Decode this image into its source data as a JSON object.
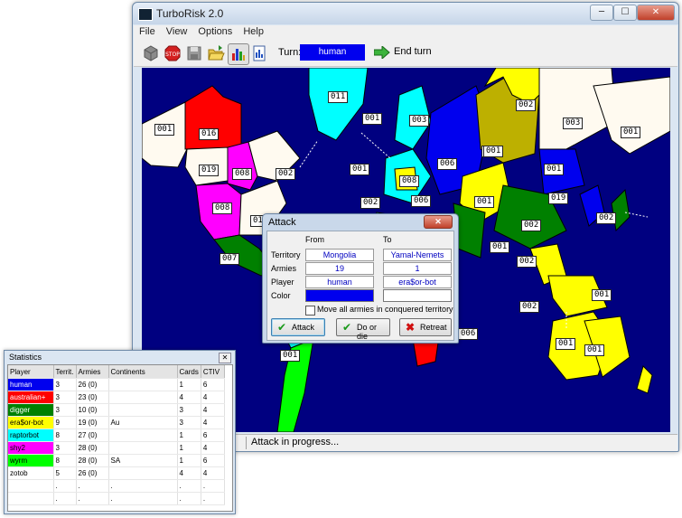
{
  "window": {
    "title": "TurboRisk 2.0",
    "min_glyph": "─",
    "max_glyph": "☐",
    "close_glyph": "✕"
  },
  "menu": [
    "File",
    "View",
    "Options",
    "Help"
  ],
  "toolbar": {
    "turn_label": "Turn:",
    "turn_player": "human",
    "end_turn": "End turn"
  },
  "status": {
    "message": "Attack in progress..."
  },
  "map_labels": [
    {
      "text": "011"
    },
    {
      "text": "001"
    },
    {
      "text": "016"
    },
    {
      "text": "001"
    },
    {
      "text": "019"
    },
    {
      "text": "008"
    },
    {
      "text": "002"
    },
    {
      "text": "008"
    },
    {
      "text": "01"
    },
    {
      "text": "007"
    },
    {
      "text": "001"
    },
    {
      "text": "003"
    },
    {
      "text": "001"
    },
    {
      "text": "008"
    },
    {
      "text": "006"
    },
    {
      "text": "002"
    },
    {
      "text": "006"
    },
    {
      "text": "002"
    },
    {
      "text": "001"
    },
    {
      "text": "003"
    },
    {
      "text": "001"
    },
    {
      "text": "001"
    },
    {
      "text": "001"
    },
    {
      "text": "019"
    },
    {
      "text": "002"
    },
    {
      "text": "002"
    },
    {
      "text": "001"
    },
    {
      "text": "002"
    },
    {
      "text": "002"
    },
    {
      "text": "001"
    },
    {
      "text": "001"
    },
    {
      "text": "001"
    },
    {
      "text": "006"
    },
    {
      "text": "001"
    }
  ],
  "attack": {
    "title": "Attack",
    "close_glyph": "✕",
    "from_label": "From",
    "to_label": "To",
    "rows": {
      "territory": {
        "label": "Territory",
        "from": "Mongolia",
        "to": "Yamal-Nemets"
      },
      "armies": {
        "label": "Armies",
        "from": "19",
        "to": "1"
      },
      "player": {
        "label": "Player",
        "from": "human",
        "to": "era$or-bot"
      },
      "color": {
        "label": "Color",
        "from": "#0000ee",
        "to": "#ffffff"
      }
    },
    "move_all": "Move all armies in conquered territory",
    "buttons": {
      "attack": "Attack",
      "do_or_die": "Do or die",
      "retreat": "Retreat"
    }
  },
  "statistics": {
    "title": "Statistics",
    "close_glyph": "✕",
    "columns": [
      "Player",
      "Territ.",
      "Armies",
      "Continents",
      "Cards",
      "CTIV"
    ],
    "rows": [
      {
        "player": "human",
        "color": "#0000ee",
        "text_color": "#ffffff",
        "territ": "3",
        "armies": "26 (0)",
        "continents": "",
        "cards": "1",
        "ctiv": "6"
      },
      {
        "player": "australian+",
        "color": "#ff0000",
        "text_color": "#ffffff",
        "territ": "3",
        "armies": "23 (0)",
        "continents": "",
        "cards": "4",
        "ctiv": "4"
      },
      {
        "player": "digger",
        "color": "#008000",
        "text_color": "#ffffff",
        "territ": "3",
        "armies": "10 (0)",
        "continents": "",
        "cards": "3",
        "ctiv": "4"
      },
      {
        "player": "era$or-bot",
        "color": "#ffff00",
        "text_color": "#000000",
        "territ": "9",
        "armies": "19 (0)",
        "continents": "Au",
        "cards": "3",
        "ctiv": "4"
      },
      {
        "player": "raptorbot",
        "color": "#00ffff",
        "text_color": "#000000",
        "territ": "8",
        "armies": "27 (0)",
        "continents": "",
        "cards": "1",
        "ctiv": "6"
      },
      {
        "player": "shy2",
        "color": "#ff00ff",
        "text_color": "#000000",
        "territ": "3",
        "armies": "28 (0)",
        "continents": "",
        "cards": "1",
        "ctiv": "4"
      },
      {
        "player": "wyrm",
        "color": "#00ff00",
        "text_color": "#000000",
        "territ": "8",
        "armies": "28 (0)",
        "continents": "SA",
        "cards": "1",
        "ctiv": "6"
      },
      {
        "player": "zotob",
        "color": "#ffffff",
        "text_color": "#000000",
        "territ": "5",
        "armies": "26 (0)",
        "continents": "",
        "cards": "4",
        "ctiv": "4"
      },
      {
        "player": "",
        "color": "#ffffff",
        "text_color": "#000000",
        "territ": ".",
        "armies": ".",
        "continents": ".",
        "cards": ".",
        "ctiv": "."
      },
      {
        "player": "",
        "color": "#ffffff",
        "text_color": "#000000",
        "territ": ".",
        "armies": ".",
        "continents": ".",
        "cards": ".",
        "ctiv": "."
      }
    ]
  }
}
